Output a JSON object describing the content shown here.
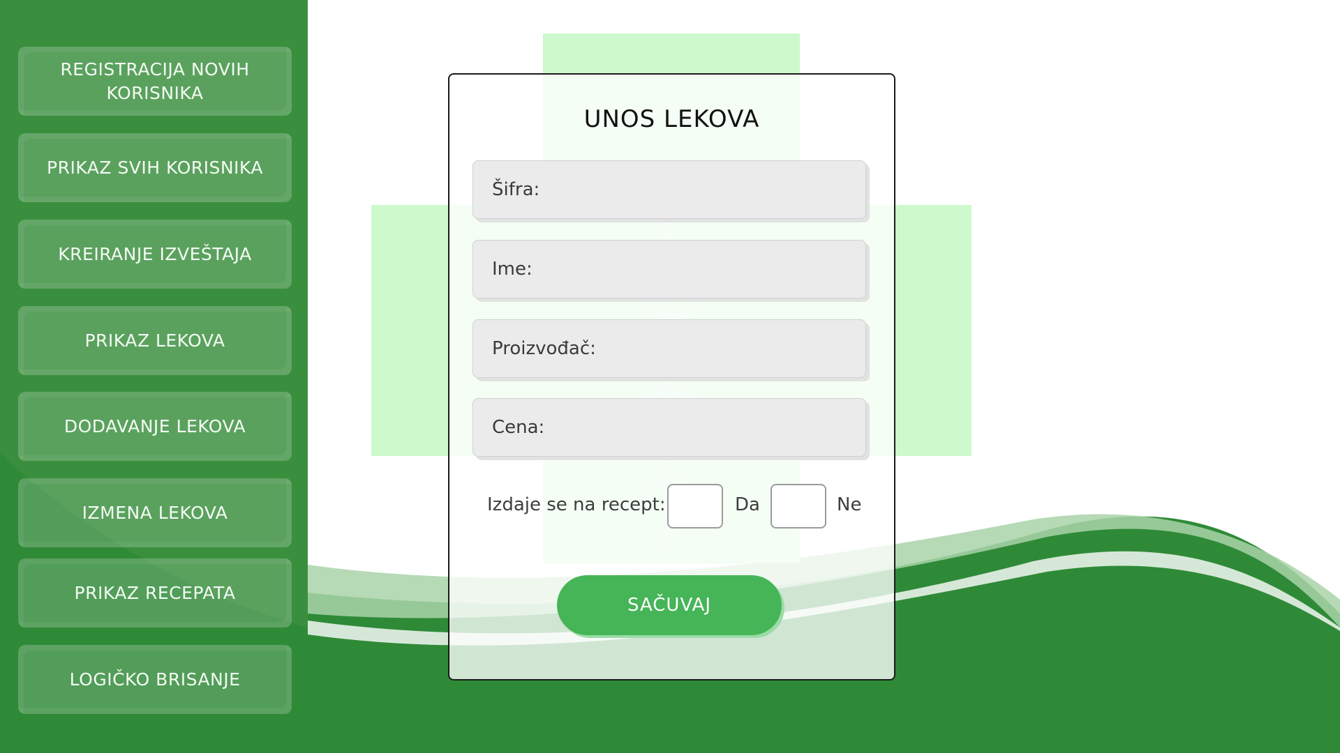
{
  "sidebar": {
    "items": [
      {
        "label": "REGISTRACIJA NOVIH KORISNIKA"
      },
      {
        "label": "PRIKAZ SVIH KORISNIKA"
      },
      {
        "label": "KREIRANJE IZVEŠTAJA"
      },
      {
        "label": "PRIKAZ LEKOVA"
      },
      {
        "label": "DODAVANJE LEKOVA"
      },
      {
        "label": "IZMENA LEKOVA"
      },
      {
        "label": "PRIKAZ RECEPATA"
      },
      {
        "label": "LOGIČKO BRISANJE"
      }
    ]
  },
  "form": {
    "title": "UNOS LEKOVA",
    "fields": {
      "sifra": {
        "placeholder": "Šifra:"
      },
      "ime": {
        "placeholder": "Ime:"
      },
      "proizvodjac": {
        "placeholder": "Proizvođač:"
      },
      "cena": {
        "placeholder": "Cena:"
      }
    },
    "prescription": {
      "label": "Izdaje se na recept:",
      "yes_label": "Da",
      "no_label": "Ne"
    },
    "save_label": "SAČUVAJ"
  },
  "colors": {
    "sidebar": "#3a8f3e",
    "wave": "#2f8a38",
    "cross": "#cdf9cd",
    "save_button": "#45b558"
  },
  "icons": {
    "background": "caduceus-icon"
  }
}
